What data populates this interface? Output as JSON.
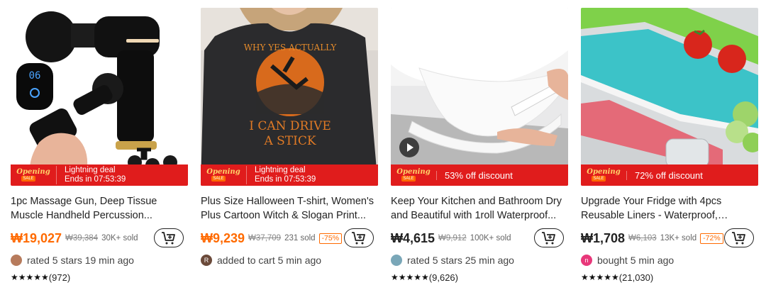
{
  "products": [
    {
      "banner_text1": "Lightning deal",
      "banner_text2": "Ends in 07:53:39",
      "opening_word": "Opening",
      "opening_sub": "SALE",
      "title": "1pc Massage Gun, Deep Tissue Muscle Handheld Percussion...",
      "price": "₩19,027",
      "old_price": "₩39,384",
      "sold": "30K+ sold",
      "discount": "",
      "activity": "rated 5 stars 19 min ago",
      "avatar_letter": "",
      "avatar_color": "#b77b5c",
      "stars": "★★★★★",
      "reviews": "(972)",
      "screen_value": "06"
    },
    {
      "banner_text1": "Lightning deal",
      "banner_text2": "Ends in 07:53:39",
      "opening_word": "Opening",
      "opening_sub": "SALE",
      "title": "Plus Size Halloween T-shirt, Women's Plus Cartoon Witch & Slogan Print...",
      "price": "₩9,239",
      "old_price": "₩37,709",
      "sold": "231 sold",
      "discount": "-75%",
      "activity": "added to cart 5 min ago",
      "avatar_letter": "R",
      "avatar_color": "#6b4a3a",
      "stars": "",
      "reviews": "",
      "shirt_text1": "WHY YES ACTUALLY",
      "shirt_text2": "I CAN DRIVE",
      "shirt_text3": "A STICK"
    },
    {
      "banner_text1": "53% off discount",
      "banner_text2": "",
      "opening_word": "Opening",
      "opening_sub": "SALE",
      "title": "Keep Your Kitchen and Bathroom Dry and Beautiful with 1roll Waterproof...",
      "price": "₩4,615",
      "old_price": "₩9,912",
      "sold": "100K+ sold",
      "discount": "",
      "activity": "rated 5 stars 25 min ago",
      "avatar_letter": "",
      "avatar_color": "#7aa7b8",
      "stars": "★★★★★",
      "reviews": "(9,626)"
    },
    {
      "banner_text1": "72% off discount",
      "banner_text2": "",
      "opening_word": "Opening",
      "opening_sub": "SALE",
      "title": "Upgrade Your Fridge with 4pcs Reusable Liners - Waterproof, Oilpro...",
      "price": "₩1,708",
      "old_price": "₩6,103",
      "sold": "13K+ sold",
      "discount": "-72%",
      "activity": "bought 5 min ago",
      "avatar_letter": "n",
      "avatar_color": "#e8387a",
      "stars": "★★★★★",
      "reviews": "(21,030)"
    }
  ],
  "colors": {
    "banner": "#e01c1c",
    "price_highlight": "#ff6a00"
  }
}
